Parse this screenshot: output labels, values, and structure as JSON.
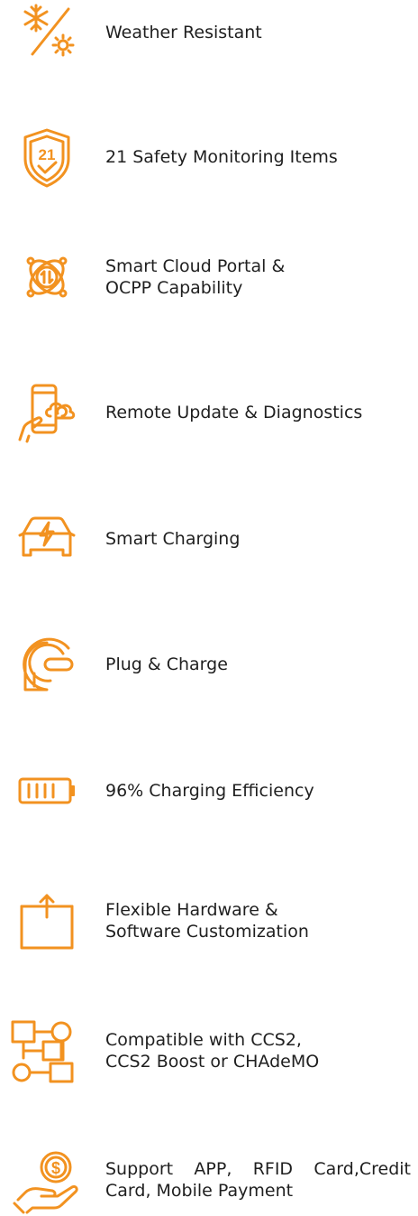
{
  "theme": {
    "accent": "#f29220",
    "text": "#1f1f1f",
    "background": "#ffffff"
  },
  "features": [
    {
      "icon": "snowflake-sun-icon",
      "label": "Weather Resistant"
    },
    {
      "icon": "shield-21-check-icon",
      "label": "21 Safety Monitoring Items"
    },
    {
      "icon": "cloud-portal-sync-icon",
      "label": "Smart Cloud Portal &\nOCPP Capability"
    },
    {
      "icon": "phone-cloud-update-icon",
      "label": "Remote Update & Diagnostics"
    },
    {
      "icon": "car-lightning-icon",
      "label": "Smart Charging"
    },
    {
      "icon": "plug-charge-icon",
      "label": "Plug & Charge"
    },
    {
      "icon": "battery-icon",
      "label": "96% Charging Efficiency"
    },
    {
      "icon": "box-upload-icon",
      "label": "Flexible Hardware &\nSoftware Customization"
    },
    {
      "icon": "connector-blocks-icon",
      "label": "Compatible with CCS2,\nCCS2 Boost or CHAdeMO"
    },
    {
      "icon": "hand-coin-payment-icon",
      "label": "Support APP, RFID Card,Credit Card, Mobile Payment"
    }
  ]
}
